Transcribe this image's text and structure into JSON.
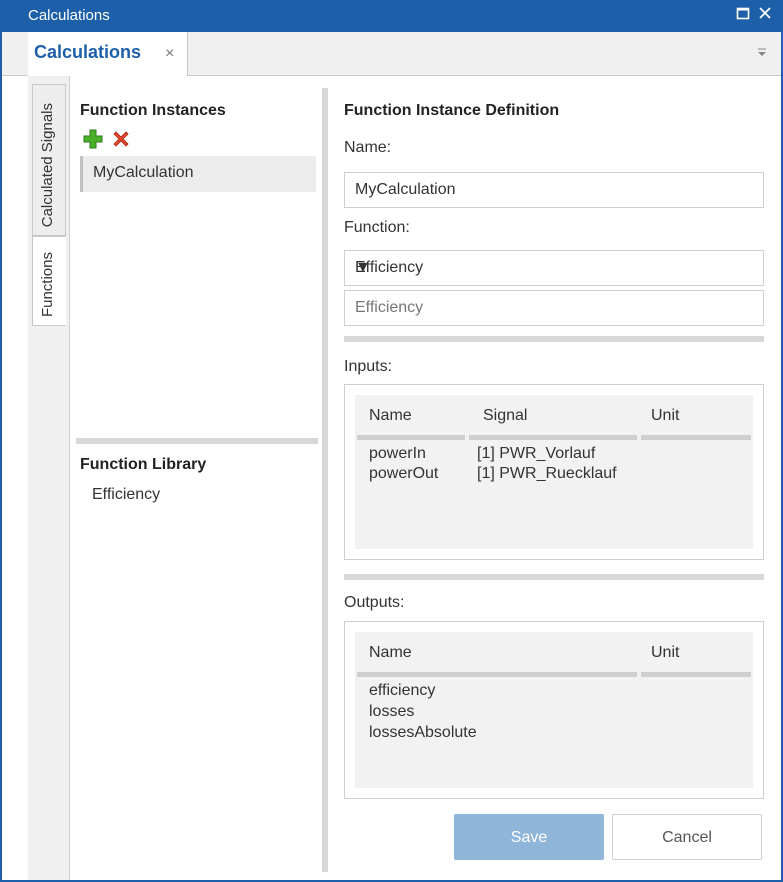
{
  "window": {
    "title": "Calculations"
  },
  "tab": {
    "label": "Calculations",
    "close": "×"
  },
  "side_tabs": {
    "calculated_signals": "Calculated Signals",
    "functions": "Functions"
  },
  "left": {
    "instances_title": "Function Instances",
    "instances": [
      "MyCalculation"
    ],
    "library_title": "Function Library",
    "library": [
      "Efficiency"
    ]
  },
  "right": {
    "title": "Function Instance Definition",
    "name_label": "Name:",
    "name_value": "MyCalculation",
    "function_label": "Function:",
    "function_value": "Efficiency",
    "function_desc": "Efficiency",
    "inputs_label": "Inputs:",
    "inputs_headers": {
      "name": "Name",
      "signal": "Signal",
      "unit": "Unit"
    },
    "inputs_rows": [
      {
        "name": "powerIn",
        "signal": "[1] PWR_Vorlauf",
        "unit": ""
      },
      {
        "name": "powerOut",
        "signal": "[1] PWR_Ruecklauf",
        "unit": ""
      }
    ],
    "outputs_label": "Outputs:",
    "outputs_headers": {
      "name": "Name",
      "unit": "Unit"
    },
    "outputs_rows": [
      {
        "name": "efficiency",
        "unit": ""
      },
      {
        "name": "losses",
        "unit": ""
      },
      {
        "name": "lossesAbsolute",
        "unit": ""
      }
    ],
    "save_label": "Save",
    "cancel_label": "Cancel"
  },
  "colors": {
    "accent": "#1d5fa8",
    "save_bg": "#8fb5d9",
    "add_icon": "#4caf28",
    "delete_icon": "#e0452b"
  },
  "icons": [
    "add-icon",
    "delete-icon",
    "maximize-icon",
    "close-icon",
    "dropdown-icon"
  ]
}
